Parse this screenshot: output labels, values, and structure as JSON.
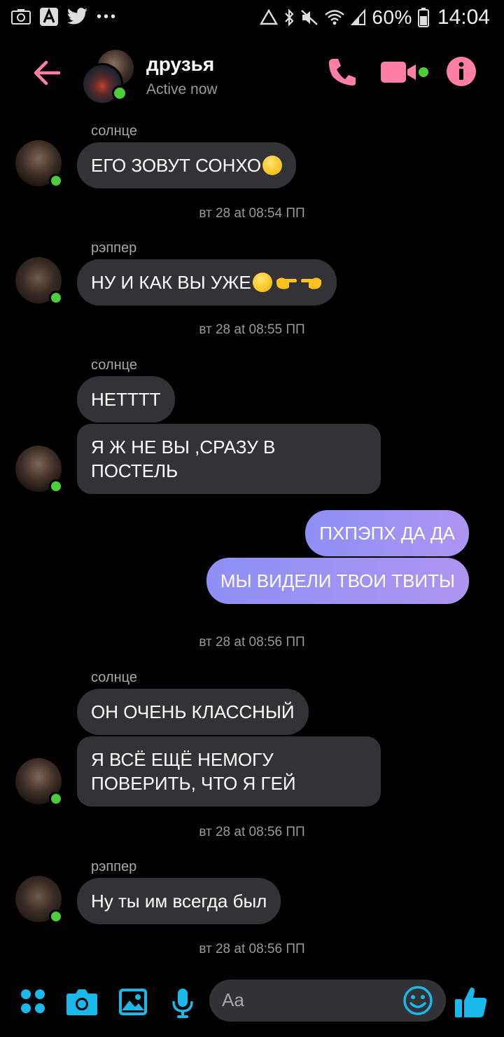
{
  "status_bar": {
    "battery": "60%",
    "time": "14:04",
    "left_icons": [
      "screenshot-icon",
      "text-app-icon",
      "twitter-icon",
      "more-icon"
    ],
    "right_icons": [
      "recycle-icon",
      "bluetooth-icon",
      "mute-icon",
      "wifi-icon",
      "signal-icon",
      "battery-icon"
    ]
  },
  "header": {
    "title": "друзья",
    "subtitle": "Active now",
    "accent_color": "#ff7fa6"
  },
  "messages": [
    {
      "type": "sender",
      "text": "солнце"
    },
    {
      "type": "in",
      "text": "ЕГО ЗОВУТ СОНХО",
      "emoji": "huffing-face"
    },
    {
      "type": "time",
      "text": "вт 28 at 08:54 ПП"
    },
    {
      "type": "sender",
      "text": "рэппер"
    },
    {
      "type": "in",
      "text": "НУ И КАК ВЫ УЖЕ",
      "emoji": "smirk-face pointing-hands"
    },
    {
      "type": "time",
      "text": "вт 28 at 08:55 ПП"
    },
    {
      "type": "sender",
      "text": "солнце"
    },
    {
      "type": "in",
      "text": "НЕТТТТ"
    },
    {
      "type": "in",
      "text": "Я Ж НЕ ВЫ ,СРАЗУ В ПОСТЕЛЬ"
    },
    {
      "type": "out",
      "text": "ПХПЭПХ ДА ДА"
    },
    {
      "type": "out",
      "text": "МЫ ВИДЕЛИ ТВОИ ТВИТЫ"
    },
    {
      "type": "time",
      "text": "вт 28 at 08:56 ПП"
    },
    {
      "type": "sender",
      "text": "солнце"
    },
    {
      "type": "in",
      "text": "ОН ОЧЕНЬ КЛАССНЫЙ"
    },
    {
      "type": "in",
      "text": "Я ВСЁ ЕЩЁ НЕМОГУ ПОВЕРИТЬ, ЧТО Я ГЕЙ"
    },
    {
      "type": "time",
      "text": "вт 28 at 08:56 ПП"
    },
    {
      "type": "sender",
      "text": "рэппер"
    },
    {
      "type": "in",
      "text": "Ну ты им всегда был"
    },
    {
      "type": "time",
      "text": "вт 28 at 08:56 ПП"
    }
  ],
  "composer": {
    "placeholder": "Aa",
    "icon_color": "#19b9ec"
  }
}
